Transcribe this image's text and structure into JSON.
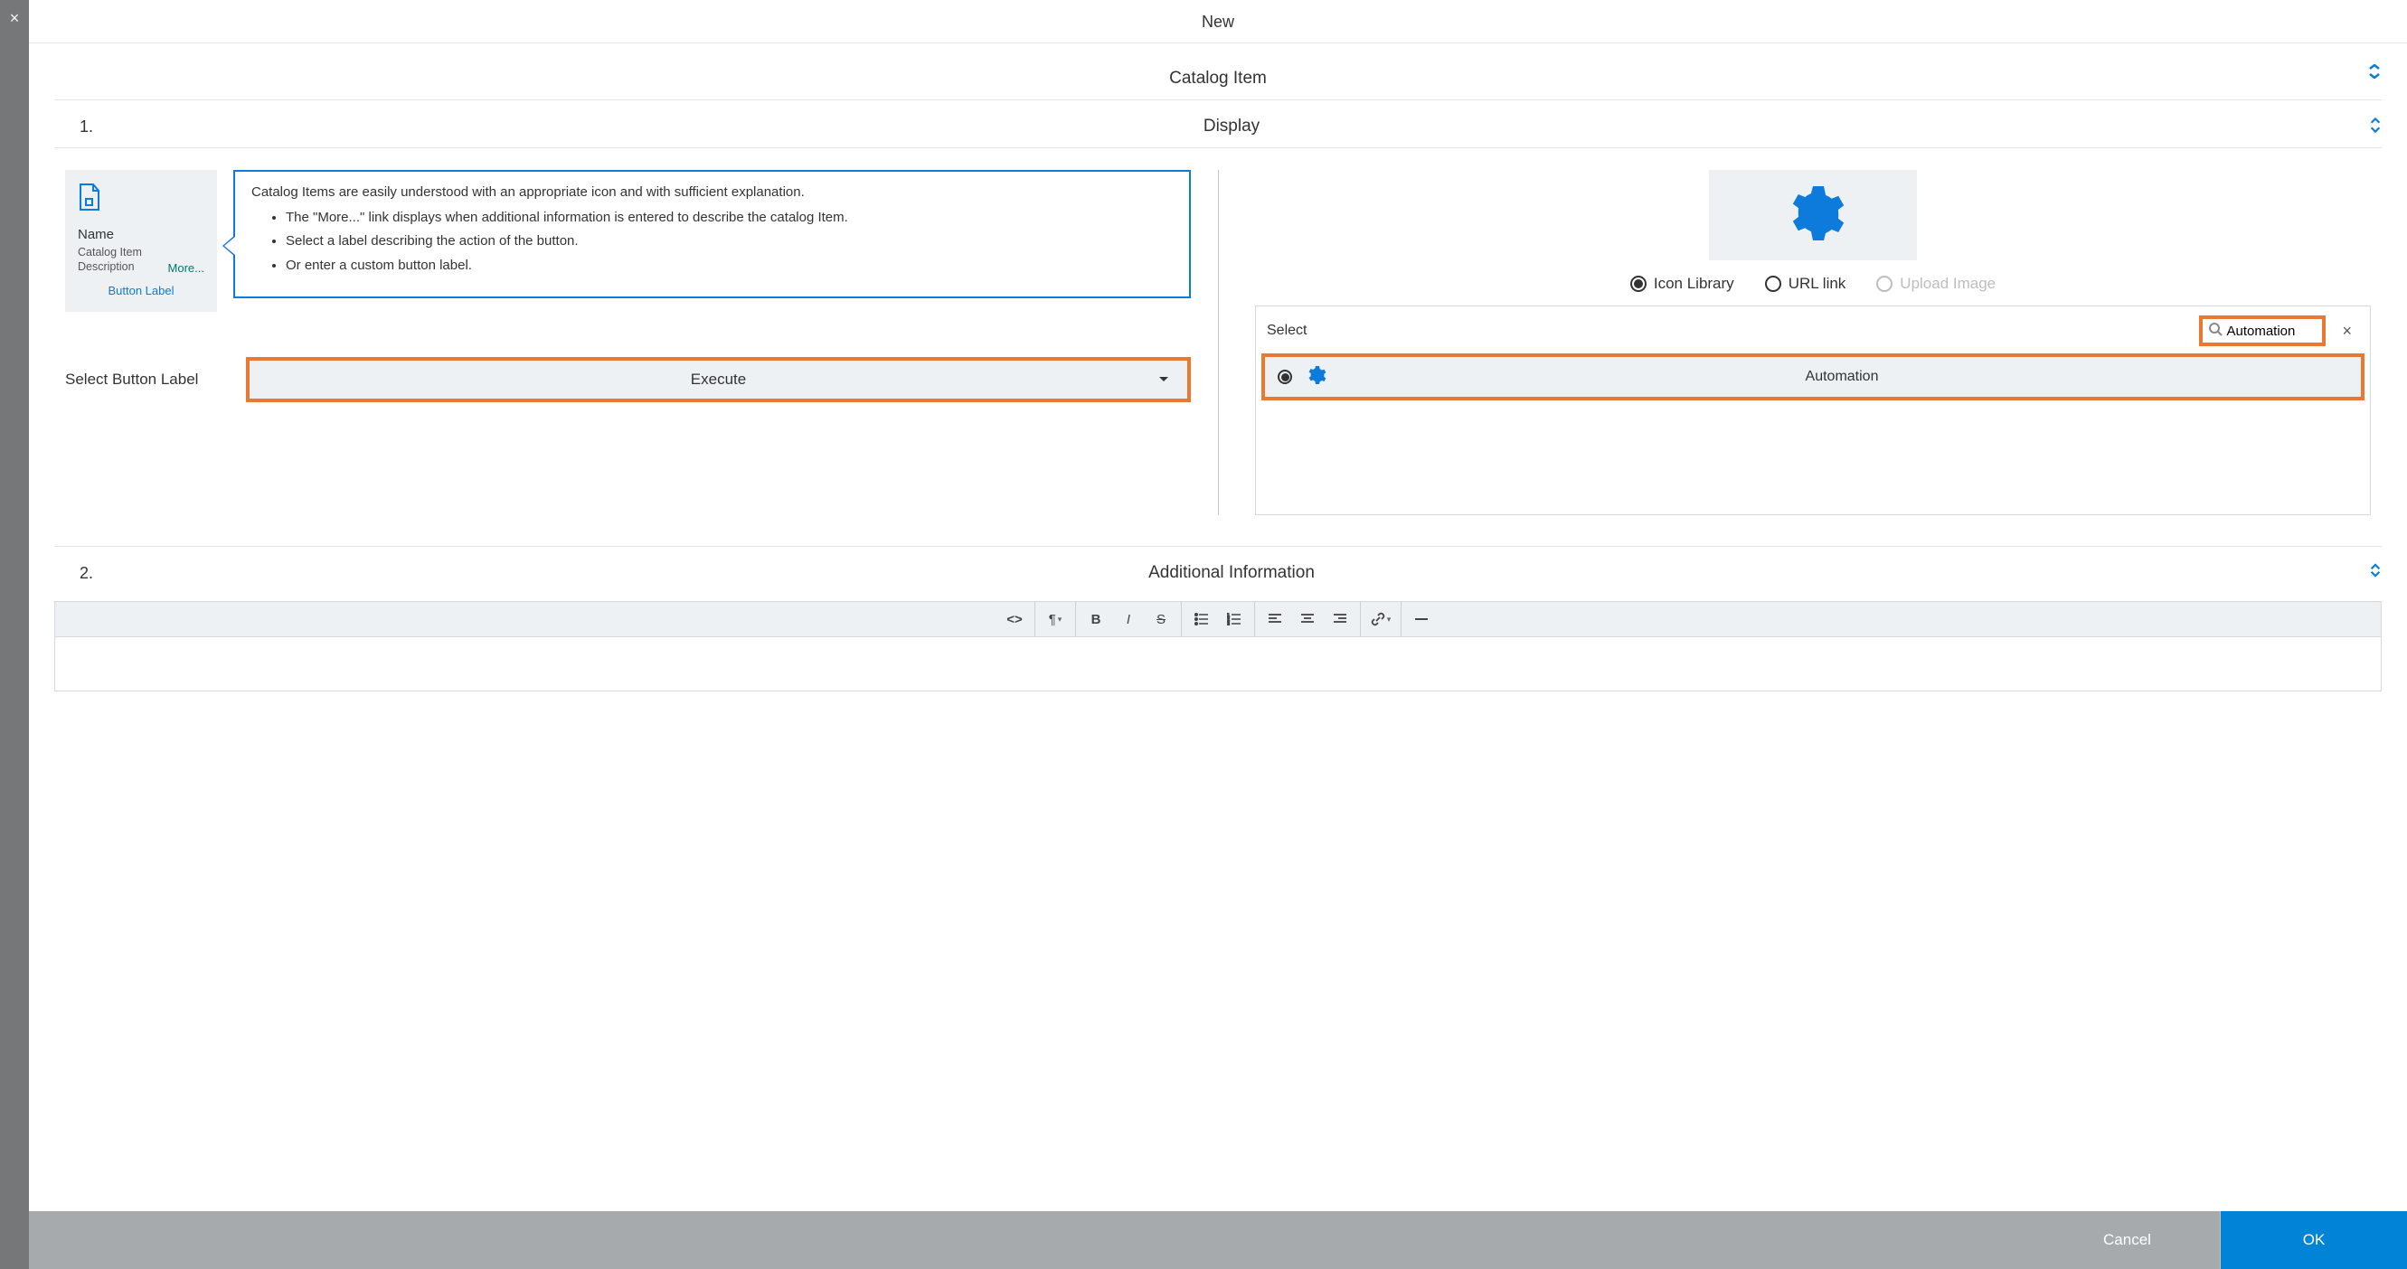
{
  "header": {
    "title": "New"
  },
  "sections": {
    "catalog_item_title": "Catalog Item",
    "display": {
      "num": "1.",
      "title": "Display"
    },
    "additional": {
      "num": "2.",
      "title": "Additional Information"
    }
  },
  "preview": {
    "name_label": "Name",
    "description": "Catalog Item Description",
    "more": "More...",
    "button_label": "Button Label"
  },
  "callout": {
    "intro": "Catalog Items are easily understood with an appropriate icon and with sufficient explanation.",
    "bullets": [
      "The \"More...\" link displays when additional information is entered to describe the catalog Item.",
      "Select a label describing the action of the button.",
      "Or enter a custom button label."
    ]
  },
  "button_label_select": {
    "label": "Select Button Label",
    "value": "Execute"
  },
  "icon_source": {
    "options": {
      "icon_library": "Icon Library",
      "url_link": "URL link",
      "upload_image": "Upload Image"
    },
    "select_label": "Select",
    "search_value": "Automation",
    "result_label": "Automation"
  },
  "icons": {
    "file": "file",
    "gear": "gear",
    "search": "search",
    "close": "×",
    "caret": "▼"
  },
  "footer": {
    "cancel": "Cancel",
    "ok": "OK"
  }
}
